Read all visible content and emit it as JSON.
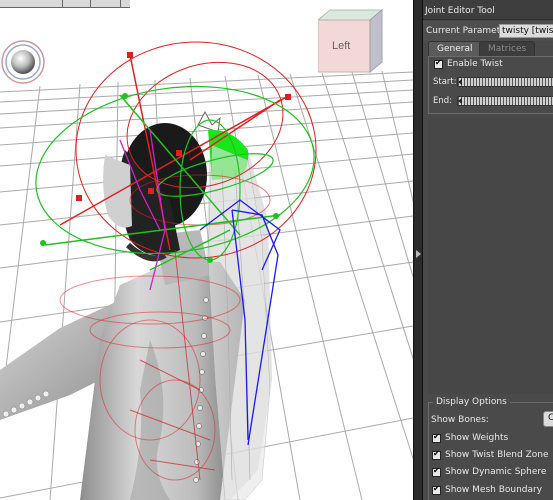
{
  "viewport": {
    "view_cube_label": "Left"
  },
  "panel": {
    "title": "Joint Editor Tool",
    "current_parameter_label": "Current Parameter:",
    "current_parameter_value": "twisty [twist]",
    "tabs": [
      {
        "label": "General",
        "active": true
      },
      {
        "label": "Matrices",
        "active": false
      }
    ],
    "enable_twist": {
      "label": "Enable Twist",
      "checked": true
    },
    "start_label": "Start:",
    "end_label": "End:",
    "display_options": {
      "title": "Display Options",
      "show_bones_label": "Show Bones:",
      "show_bones_value": "C",
      "options": [
        {
          "label": "Show Weights",
          "checked": true
        },
        {
          "label": "Show Twist Blend Zone",
          "checked": true
        },
        {
          "label": "Show Dynamic Sphere",
          "checked": true
        },
        {
          "label": "Show Mesh Boundary",
          "checked": true
        }
      ]
    }
  },
  "colors": {
    "panel_bg": "#4a4a4a",
    "twist_zone": "#19e619",
    "joint_red": "#e02020",
    "joint_green": "#20c020",
    "bone_blue": "#1a1aee"
  }
}
